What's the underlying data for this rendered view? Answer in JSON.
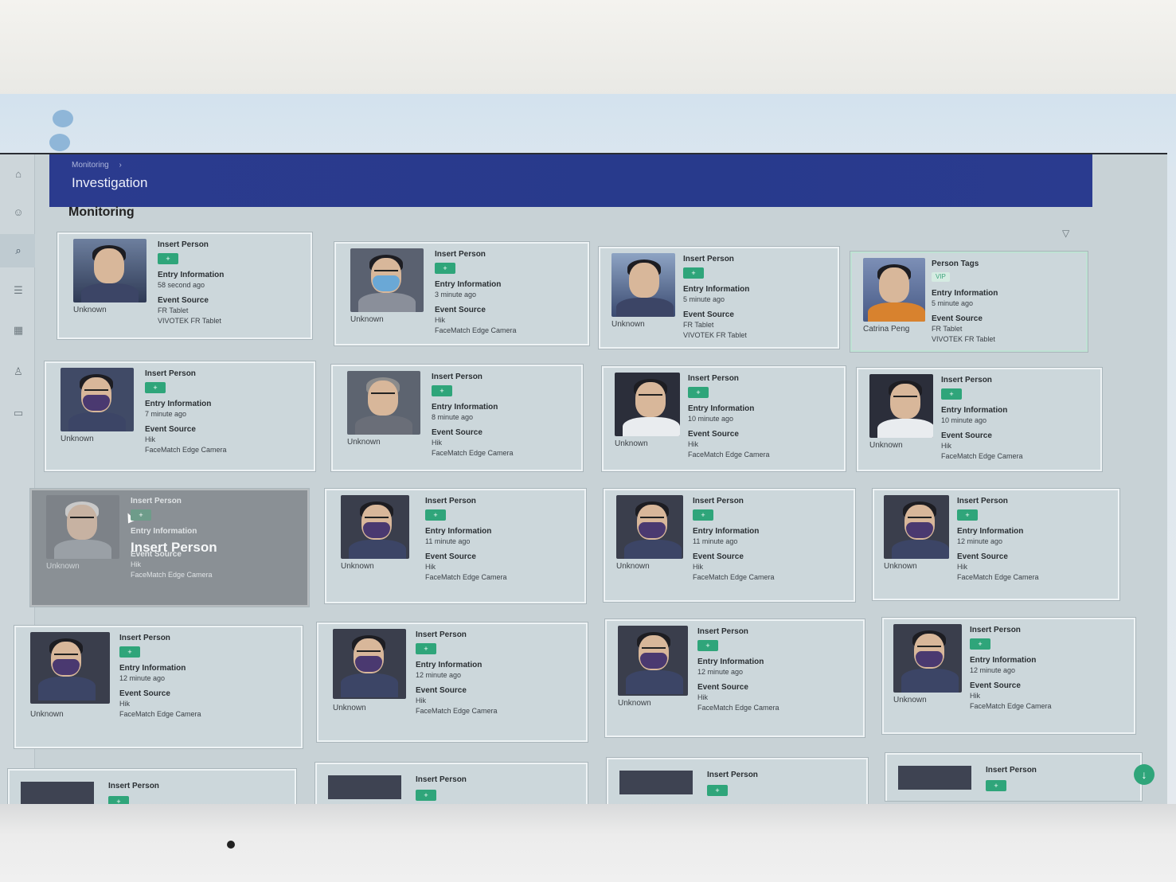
{
  "breadcrumb": {
    "parent": "Monitoring",
    "separator": "›"
  },
  "header": {
    "title": "Investigation"
  },
  "section": {
    "title": "Monitoring"
  },
  "icons": {
    "home": "home-icon",
    "menu": "double-chevron-icon",
    "people": "people-icon",
    "search": "search-icon",
    "list": "list-icon",
    "building": "building-icon",
    "person": "person-icon",
    "card": "id-card-icon",
    "filter": "filter-icon",
    "add_person": "add-person-icon",
    "download": "download-icon"
  },
  "colors": {
    "header": "#2b3b8e",
    "accent": "#2fa57a",
    "card_bg": "#ccd7db"
  },
  "labels": {
    "insert_person": "Insert Person",
    "person_tags": "Person Tags",
    "entry_information": "Entry Information",
    "event_source": "Event Source",
    "hover_text": "Insert Person"
  },
  "cards": [
    {
      "name": "Unknown",
      "entry": "58 second ago",
      "source1": "FR Tablet",
      "source2": "VIVOTEK FR Tablet"
    },
    {
      "name": "Unknown",
      "entry": "3 minute ago",
      "source1": "Hik",
      "source2": "FaceMatch Edge Camera"
    },
    {
      "name": "Unknown",
      "entry": "5 minute ago",
      "source1": "FR Tablet",
      "source2": "VIVOTEK FR Tablet"
    },
    {
      "name": "Catrina Peng",
      "tag": "VIP",
      "entry": "5 minute ago",
      "source1": "FR Tablet",
      "source2": "VIVOTEK FR Tablet"
    },
    {
      "name": "Unknown",
      "entry": "7 minute ago",
      "source1": "Hik",
      "source2": "FaceMatch Edge Camera"
    },
    {
      "name": "Unknown",
      "entry": "8 minute ago",
      "source1": "Hik",
      "source2": "FaceMatch Edge Camera"
    },
    {
      "name": "Unknown",
      "entry": "10 minute ago",
      "source1": "Hik",
      "source2": "FaceMatch Edge Camera"
    },
    {
      "name": "Unknown",
      "entry": "10 minute ago",
      "source1": "Hik",
      "source2": "FaceMatch Edge Camera"
    },
    {
      "name": "Unknown",
      "entry": "",
      "source1": "Hik",
      "source2": "FaceMatch Edge Camera"
    },
    {
      "name": "Unknown",
      "entry": "11 minute ago",
      "source1": "Hik",
      "source2": "FaceMatch Edge Camera"
    },
    {
      "name": "Unknown",
      "entry": "11 minute ago",
      "source1": "Hik",
      "source2": "FaceMatch Edge Camera"
    },
    {
      "name": "Unknown",
      "entry": "12 minute ago",
      "source1": "Hik",
      "source2": "FaceMatch Edge Camera"
    },
    {
      "name": "Unknown",
      "entry": "12 minute ago",
      "source1": "Hik",
      "source2": "FaceMatch Edge Camera"
    },
    {
      "name": "Unknown",
      "entry": "12 minute ago",
      "source1": "Hik",
      "source2": "FaceMatch Edge Camera"
    },
    {
      "name": "Unknown",
      "entry": "12 minute ago",
      "source1": "Hik",
      "source2": "FaceMatch Edge Camera"
    },
    {
      "name": "Unknown",
      "entry": "12 minute ago",
      "source1": "Hik",
      "source2": "FaceMatch Edge Camera"
    }
  ],
  "partial_cards": [
    {
      "label": "Insert Person"
    },
    {
      "label": "Insert Person"
    },
    {
      "label": "Insert Person"
    },
    {
      "label": "Insert Person"
    }
  ]
}
